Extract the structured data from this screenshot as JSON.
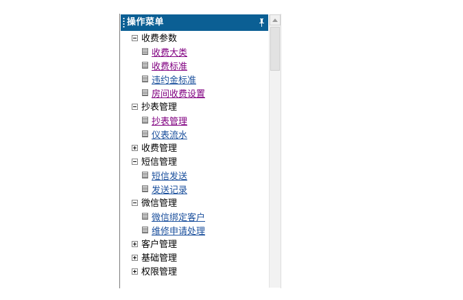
{
  "panel": {
    "title": "操作菜单",
    "header_color": "#0b5f94",
    "pin_icon": "pin-icon"
  },
  "menu": [
    {
      "label": "收费参数",
      "expanded": true,
      "children": [
        {
          "label": "收费大类",
          "visited": true
        },
        {
          "label": "收费标准",
          "visited": true
        },
        {
          "label": "违约金标准",
          "visited": false
        },
        {
          "label": "房间收费设置",
          "visited": true
        }
      ]
    },
    {
      "label": "抄表管理",
      "expanded": true,
      "children": [
        {
          "label": "抄表管理",
          "visited": true
        },
        {
          "label": "仪表流水",
          "visited": false
        }
      ]
    },
    {
      "label": "收费管理",
      "expanded": false,
      "children": []
    },
    {
      "label": "短信管理",
      "expanded": true,
      "children": [
        {
          "label": "短信发送",
          "visited": false
        },
        {
          "label": "发送记录",
          "visited": false
        }
      ]
    },
    {
      "label": "微信管理",
      "expanded": true,
      "children": [
        {
          "label": "微信绑定客户",
          "visited": false
        },
        {
          "label": "维修申请处理",
          "visited": false
        }
      ]
    },
    {
      "label": "客户管理",
      "expanded": false,
      "children": []
    },
    {
      "label": "基础管理",
      "expanded": false,
      "children": []
    },
    {
      "label": "权限管理",
      "expanded": false,
      "children": []
    }
  ]
}
